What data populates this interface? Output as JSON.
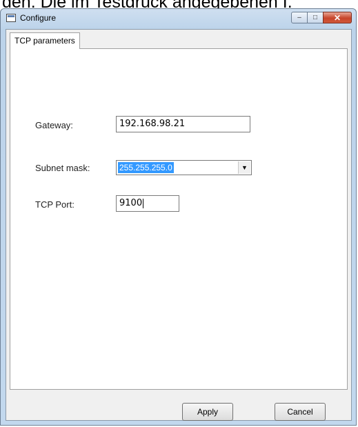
{
  "background_text": "den. Die im Testdruck angegebenen I.",
  "window": {
    "title": "Configure",
    "buttons": {
      "minimize": "–",
      "maximize": "□",
      "close": "✕"
    }
  },
  "tabs": [
    {
      "label": "TCP parameters",
      "active": true
    }
  ],
  "form": {
    "gateway": {
      "label": "Gateway:",
      "value": "192.168.98.21"
    },
    "subnet": {
      "label": "Subnet mask:",
      "value": "255.255.255.0",
      "selected": true
    },
    "port": {
      "label": "TCP Port:",
      "value": "9100"
    }
  },
  "buttons": {
    "apply": "Apply",
    "cancel": "Cancel"
  },
  "icons": {
    "app": "window-app-icon",
    "dropdown": "chevron-down-icon"
  },
  "colors": {
    "selection": "#3399ff",
    "close": "#c7452b",
    "frame": "#bcd3ea"
  }
}
